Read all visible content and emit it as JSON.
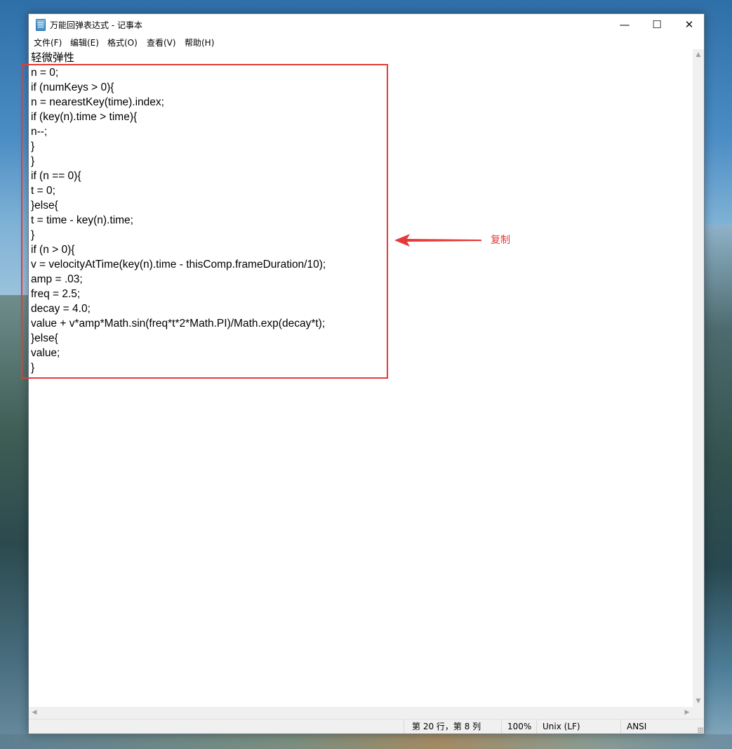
{
  "window": {
    "title": "万能回弹表达式 - 记事本",
    "minimize_symbol": "—",
    "maximize_symbol": "☐",
    "close_symbol": "✕"
  },
  "menu": {
    "file": "文件(F)",
    "edit": "编辑(E)",
    "format": "格式(O)",
    "view": "查看(V)",
    "help": "帮助(H)"
  },
  "editor": {
    "content": "轻微弹性\nn = 0;\nif (numKeys > 0){\nn = nearestKey(time).index;\nif (key(n).time > time){\nn--;\n}\n}\nif (n == 0){\nt = 0;\n}else{\nt = time - key(n).time;\n}\nif (n > 0){\nv = velocityAtTime(key(n).time - thisComp.frameDuration/10);\namp = .03;\nfreq = 2.5;\ndecay = 4.0;\nvalue + v*amp*Math.sin(freq*t*2*Math.PI)/Math.exp(decay*t);\n}else{\nvalue;\n}"
  },
  "statusbar": {
    "position": "第 20 行，第 8 列",
    "zoom": "100%",
    "line_ending": "Unix (LF)",
    "encoding": "ANSI"
  },
  "annotation": {
    "label": "复制",
    "color": "#e53a3a"
  },
  "icons": {
    "app": "notepad-icon",
    "arrow": "left-arrow-icon"
  }
}
